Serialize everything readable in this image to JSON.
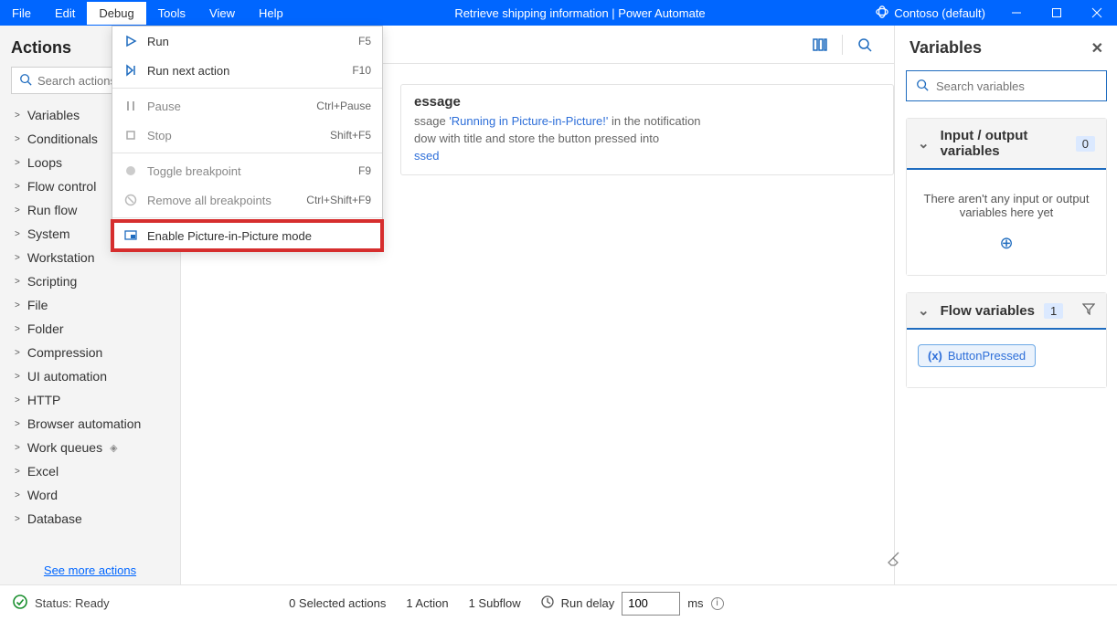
{
  "titlebar": {
    "menus": [
      "File",
      "Edit",
      "Debug",
      "Tools",
      "View",
      "Help"
    ],
    "active_menu_index": 2,
    "title": "Retrieve shipping information | Power Automate",
    "org": "Contoso (default)"
  },
  "debug_menu": {
    "items": [
      {
        "icon": "play-outline-icon",
        "label": "Run",
        "shortcut": "F5",
        "enabled": true
      },
      {
        "icon": "step-icon",
        "label": "Run next action",
        "shortcut": "F10",
        "enabled": true
      },
      {
        "sep": true
      },
      {
        "icon": "pause-icon",
        "label": "Pause",
        "shortcut": "Ctrl+Pause",
        "enabled": false
      },
      {
        "icon": "stop-icon",
        "label": "Stop",
        "shortcut": "Shift+F5",
        "enabled": false
      },
      {
        "sep": true
      },
      {
        "icon": "breakpoint-dot-icon",
        "label": "Toggle breakpoint",
        "shortcut": "F9",
        "enabled": false
      },
      {
        "icon": "remove-breakpoints-icon",
        "label": "Remove all breakpoints",
        "shortcut": "Ctrl+Shift+F9",
        "enabled": false
      },
      {
        "sep": true
      },
      {
        "icon": "pip-icon",
        "label": "Enable Picture-in-Picture mode",
        "shortcut": "",
        "enabled": true,
        "highlighted": true
      }
    ]
  },
  "actions_panel": {
    "title": "Actions",
    "search_placeholder": "Search actions",
    "categories": [
      "Variables",
      "Conditionals",
      "Loops",
      "Flow control",
      "Run flow",
      "System",
      "Workstation",
      "Scripting",
      "File",
      "Folder",
      "Compression",
      "UI automation",
      "HTTP",
      "Browser automation",
      "Work queues",
      "Excel",
      "Word",
      "Database"
    ],
    "premium_index": 14,
    "see_more": "See more actions"
  },
  "center": {
    "step_title": "essage",
    "step_line1_pre": "ssage ",
    "step_line1_blue": "'Running in Picture-in-Picture!'",
    "step_line1_post": " in the notification",
    "step_line2": "dow with title  and store the button pressed into",
    "step_var": "ssed"
  },
  "variables_panel": {
    "title": "Variables",
    "search_placeholder": "Search variables",
    "io_header": "Input / output variables",
    "io_count": "0",
    "io_empty": "There aren't any input or output variables here yet",
    "flow_header": "Flow variables",
    "flow_count": "1",
    "flow_var_name": "ButtonPressed"
  },
  "statusbar": {
    "status": "Status: Ready",
    "selected": "0 Selected actions",
    "actions": "1 Action",
    "subflows": "1 Subflow",
    "rundelay_label": "Run delay",
    "rundelay_value": "100",
    "rundelay_unit": "ms"
  }
}
